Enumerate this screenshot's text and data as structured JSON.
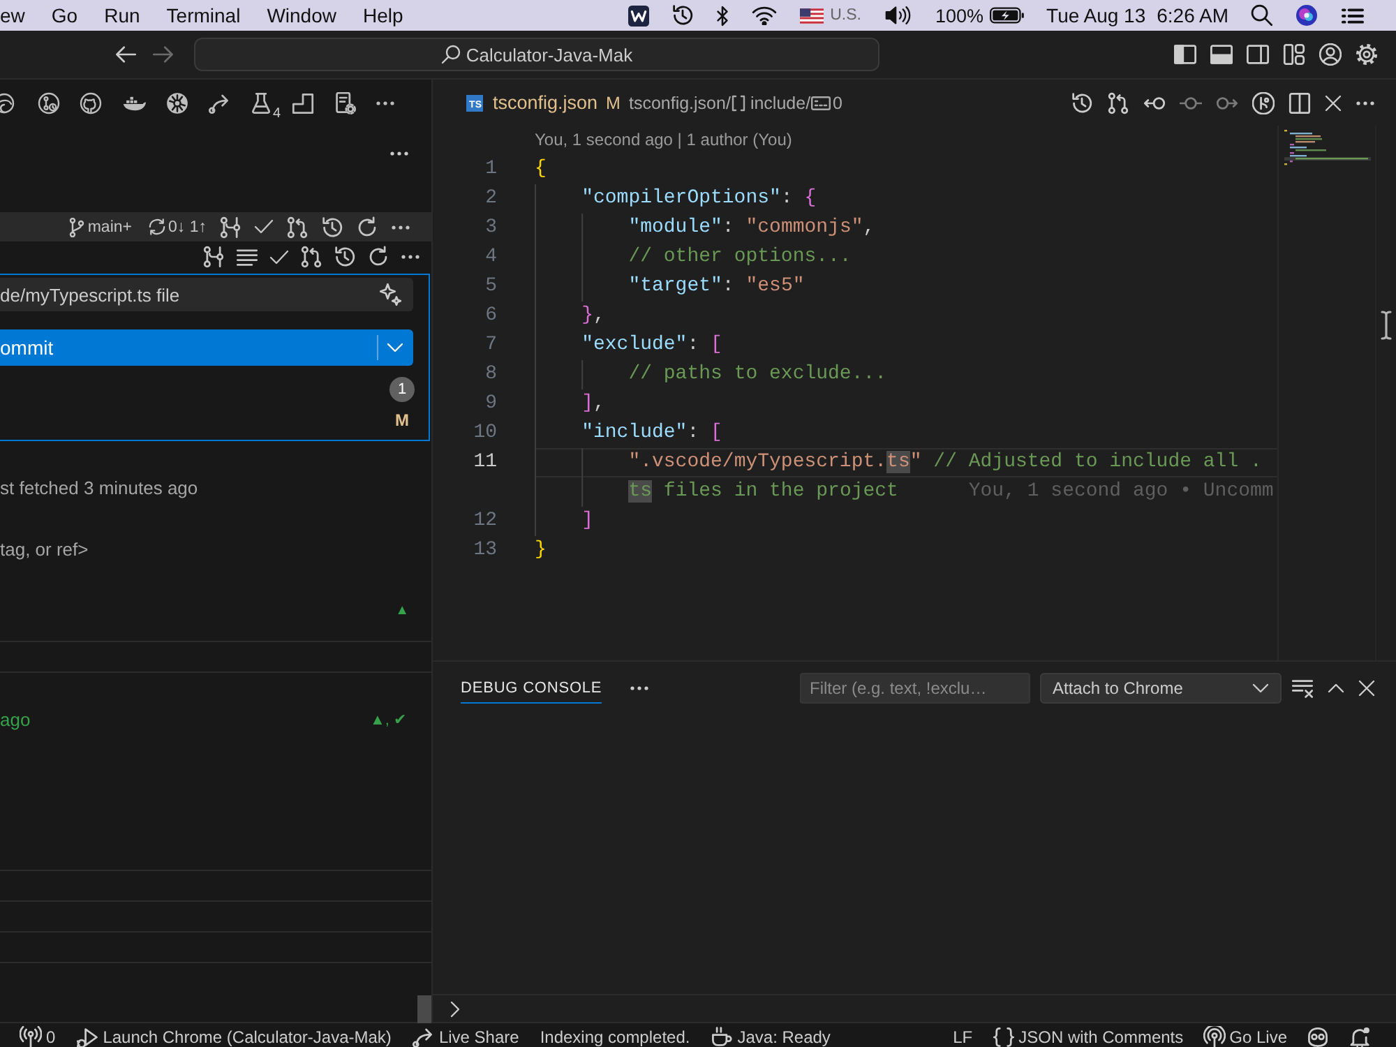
{
  "menu_bar": {
    "menus": [
      "ew",
      "Go",
      "Run",
      "Terminal",
      "Window",
      "Help"
    ],
    "input_source": "U.S.",
    "battery": "100%",
    "date": "Tue Aug 13",
    "time": "6:26 AM"
  },
  "title_bar": {
    "command_center": "Calculator-Java-Mak"
  },
  "sidebar": {
    "toolbar_badge": "4",
    "repository": {
      "branch": "main+",
      "sync": "0↓ 1↑"
    },
    "commit_message": "de/myTypescript.ts file",
    "commit_button": "ommit",
    "changes": {
      "count": "1",
      "status": "M"
    },
    "rows": [
      {
        "kind": "note",
        "text": "st fetched 3 minutes ago"
      },
      {
        "kind": "note",
        "text": "tag, or ref>"
      },
      {
        "kind": "marker",
        "text": "▲"
      }
    ],
    "commits": [
      {
        "text": "ago",
        "status": "▲, ✔"
      }
    ]
  },
  "editor": {
    "tab": {
      "icon_label": "TS",
      "label": "tsconfig.json",
      "status": "M"
    },
    "breadcrumbs": [
      {
        "kind": "file",
        "label": "tsconfig.json",
        "separator": "/"
      },
      {
        "kind": "array",
        "label": "include",
        "separator": "/"
      },
      {
        "kind": "string",
        "label": "0"
      }
    ],
    "blame_header": "You, 1 second ago | 1 author (You)",
    "lines": [
      {
        "number": "1",
        "current": false,
        "tokens": [
          {
            "text": "{",
            "kind": "brace"
          }
        ],
        "children": [
          {
            "number": "2",
            "current": false,
            "tokens": [
              {
                "text": "\"compilerOptions\"",
                "kind": "key"
              },
              {
                "text": ": ",
                "kind": "punct"
              },
              {
                "text": "{",
                "kind": "bracket"
              }
            ],
            "children": [
              {
                "number": "3",
                "current": false,
                "tokens": [
                  {
                    "text": "\"module\"",
                    "kind": "key"
                  },
                  {
                    "text": ": ",
                    "kind": "punct"
                  },
                  {
                    "text": "\"commonjs\"",
                    "kind": "string"
                  },
                  {
                    "text": ",",
                    "kind": "punct"
                  }
                ]
              },
              {
                "number": "4",
                "current": false,
                "tokens": [
                  {
                    "text": "// other options...",
                    "kind": "comment"
                  }
                ]
              },
              {
                "number": "5",
                "current": false,
                "tokens": [
                  {
                    "text": "\"target\"",
                    "kind": "key"
                  },
                  {
                    "text": ": ",
                    "kind": "punct"
                  },
                  {
                    "text": "\"es5\"",
                    "kind": "string"
                  }
                ]
              }
            ]
          },
          {
            "number": "6",
            "current": false,
            "tokens": [
              {
                "text": "}",
                "kind": "bracket"
              },
              {
                "text": ",",
                "kind": "punct"
              }
            ]
          },
          {
            "number": "7",
            "current": false,
            "tokens": [
              {
                "text": "\"exclude\"",
                "kind": "key"
              },
              {
                "text": ": ",
                "kind": "punct"
              },
              {
                "text": "[",
                "kind": "bracket"
              }
            ],
            "children": [
              {
                "number": "8",
                "current": false,
                "tokens": [
                  {
                    "text": "// paths to exclude...",
                    "kind": "comment"
                  }
                ]
              }
            ]
          },
          {
            "number": "9",
            "current": false,
            "tokens": [
              {
                "text": "]",
                "kind": "bracket"
              },
              {
                "text": ",",
                "kind": "punct"
              }
            ]
          },
          {
            "number": "10",
            "current": false,
            "tokens": [
              {
                "text": "\"include\"",
                "kind": "key"
              },
              {
                "text": ": ",
                "kind": "punct"
              },
              {
                "text": "[",
                "kind": "bracket"
              }
            ],
            "children": [
              {
                "number": "11",
                "current": true,
                "tokens": [
                  {
                    "text": "\".vscode/myTypescript.",
                    "kind": "string"
                  },
                  {
                    "text": "ts",
                    "kind": "matchstring"
                  },
                  {
                    "text": "\"",
                    "kind": "string"
                  },
                  {
                    "text": " // Adjusted to include all .",
                    "kind": "comment"
                  }
                ],
                "continuation": [
                  {
                    "text": "ts",
                    "kind": "matchcomment"
                  },
                  {
                    "text": " files in the project",
                    "kind": "comment"
                  }
                ],
                "inline_blame": "You, 1 second ago • Uncomm"
              }
            ]
          },
          {
            "number": "12",
            "current": false,
            "tokens": [
              {
                "text": "]",
                "kind": "bracket"
              }
            ]
          }
        ]
      },
      {
        "number": "13",
        "current": false,
        "tokens": [
          {
            "text": "}",
            "kind": "brace"
          }
        ]
      }
    ]
  },
  "panel": {
    "tabs": [
      {
        "label": "DEBUG CONSOLE",
        "selected": true
      }
    ],
    "filter": {
      "placeholder": "Filter (e.g. text, !exclu…"
    },
    "launch_config": "Attach to Chrome"
  },
  "status_bar": {
    "left": [
      {
        "kind": "ports",
        "label": "0"
      },
      {
        "kind": "launch",
        "label": "Launch Chrome (Calculator-Java-Mak)"
      },
      {
        "kind": "share",
        "label": "Live Share"
      },
      {
        "kind": "text",
        "label": "Indexing completed."
      },
      {
        "kind": "java",
        "label": "Java: Ready"
      }
    ],
    "right": [
      {
        "kind": "text",
        "label": "LF"
      },
      {
        "kind": "language",
        "label": "JSON with Comments"
      },
      {
        "kind": "golive",
        "label": "Go Live"
      },
      {
        "kind": "copilot"
      },
      {
        "kind": "bell"
      }
    ]
  }
}
